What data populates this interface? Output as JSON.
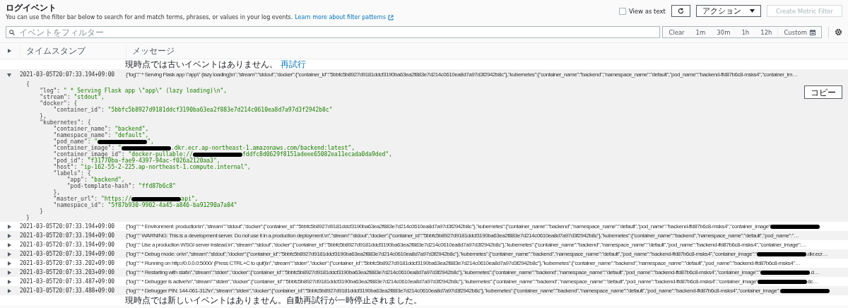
{
  "title": "ログイベント",
  "description": "You can use the filter bar below to search for and match terms, phrases, or values in your log events.",
  "learn_more_link": "Learn more about filter patterns",
  "view_as_text": {
    "label": "View as text",
    "checked": false
  },
  "actions_button": "アクション",
  "create_metric_filter": {
    "label": "Create Metric Filter",
    "disabled": true
  },
  "search": {
    "placeholder": "イベントをフィルター"
  },
  "time_ranges": [
    {
      "label": "Clear",
      "kind": "preset"
    },
    {
      "label": "1m",
      "kind": "preset"
    },
    {
      "label": "30m",
      "kind": "preset"
    },
    {
      "label": "1h",
      "kind": "preset"
    },
    {
      "label": "12h",
      "kind": "preset"
    },
    {
      "label": "Custom",
      "kind": "custom"
    }
  ],
  "columns": [
    "タイムスタンプ",
    "メッセージ"
  ],
  "older_notice": {
    "text": "現時点では古いイベントはありません。",
    "link": "再試行"
  },
  "copy_button": "コピー",
  "events": [
    {
      "timestamp": "2021-03-05T20:07:33.194+09:00",
      "expanded": true,
      "message": {
        "text": "{\"log\":\" * Serving Flask app \\\"app\\\" (lazy loading)\\n\",\"stream\":\"stdout\",\"docker\":{\"container_id\":\"5bbfc5b8927d9181ddcf3190ba63ea2f883e7d214c0610ea8d7a97d3f2942b8c\"},\"kubernetes\":{\"container_name\":\"backend\",\"namespace_name\":\"default\",\"pod_name\":\"backend-ffd87b6c8-msks4\",\"container_im…",
        "redacted": false
      },
      "detail_lines": [
        {
          "key": "{"
        },
        {
          "key": "    \"log\": ",
          "value": "\" * Serving Flask app \\\"app\\\" (lazy loading)\\n\","
        },
        {
          "key": "    \"stream\": ",
          "value": "\"stdout\","
        },
        {
          "key": "    \"docker\": {"
        },
        {
          "key": "        \"container_id\": ",
          "value": "\"5bbfc5b8927d9181ddcf3190ba63ea2f883e7d214c0610ea8d7a97d3f2942b8c\""
        },
        {
          "key": "    },"
        },
        {
          "key": "    \"kubernetes\": {"
        },
        {
          "key": "        \"container_name\": ",
          "value": "\"backend\","
        },
        {
          "key": "        \"namespace_name\": ",
          "value": "\"default\","
        },
        {
          "key": "        \"pod_name\": ",
          "value": "\"",
          "redacted": true,
          "after": "\","
        },
        {
          "key": "        \"container_image\": ",
          "value": "\"",
          "redacted": true,
          "after": ".dkr.ecr.ap-northeast-1.amazonaws.com/backend:latest\","
        },
        {
          "key": "        \"container_image_id\": ",
          "value": "\"docker-pullable://",
          "redacted": true,
          "after": "fddfc8d0629f8151adeee65082ea11ecada0da9ded\","
        },
        {
          "key": "        \"pod_id\": ",
          "value": "\"f31770ba-fae9-4397-94ac-f026a2120aa3\","
        },
        {
          "key": "        \"host\": ",
          "value": "\"ip-162-55-2-225.ap-northeast-1.compute.internal\","
        },
        {
          "key": "        \"labels\": {"
        },
        {
          "key": "            \"app\": ",
          "value": "\"backend\","
        },
        {
          "key": "            \"pod-template-hash\": ",
          "value": "\"ffd87b6c8\""
        },
        {
          "key": "        },"
        },
        {
          "key": "        \"master_url\": ",
          "value": "\"https://",
          "redacted": true,
          "after": "api\","
        },
        {
          "key": "        \"namespace_id\": ",
          "value": "\"5f87b930-9902-4a45-a846-ba91290a7a04\""
        },
        {
          "key": "    }"
        },
        {
          "key": "}"
        }
      ]
    },
    {
      "timestamp": "2021-03-05T20:07:33.194+09:00",
      "expanded": false,
      "message": {
        "text": "{\"log\":\" * Environment: production\\n\",\"stream\":\"stdout\",\"docker\":{\"container_id\":\"5bbfc5b8927d9181ddcf3190ba63ea2f883e7d214c0610ea8d7a97d3f2942b8c\"},\"kubernetes\":{\"container_name\":\"backend\",\"namespace_name\":\"default\",\"pod_name\":\"backend-ffd87b6c8-msks4\",\"container_image\"",
        "redacted": true
      }
    },
    {
      "timestamp": "2021-03-05T20:07:33.194+09:00",
      "expanded": false,
      "message": {
        "text": "{\"log\":\" WARNING: This is a development server. Do not use it in a production deployment.\\n\",\"stream\":\"stdout\",\"docker\":{\"container_id\":\"5bbfc5b8927d9181ddcf3190ba63ea2f883e7d214c0610ea8d7a97d3f2942b8c\"},\"kubernetes\":{\"container_name\":\"backend\",\"namespace_name\":\"default\",\"pod_name\":\"…",
        "redacted": false
      }
    },
    {
      "timestamp": "2021-03-05T20:07:33.194+09:00",
      "expanded": false,
      "message": {
        "text": "{\"log\":\" Use a production WSGI server instead.\\n\",\"stream\":\"stdout\",\"docker\":{\"container_id\":\"5bbfc5b8927d9181ddcf3190ba63ea2f883e7d214c0610ea8d7a97d3f2942b8c\"},\"kubernetes\":{\"container_name\":\"backend\",\"namespace_name\":\"default\",\"pod_name\":\"backend-ffd87b6c8-msks4\",\"container_image\":…",
        "redacted": false
      }
    },
    {
      "timestamp": "2021-03-05T20:07:33.194+09:00",
      "expanded": false,
      "message": {
        "text": "{\"log\":\" * Debug mode: on\\n\",\"stream\":\"stdout\",\"docker\":{\"container_id\":\"5bbfc5b8927d9181ddcf3190ba63ea2f883e7d214c0610ea8d7a97d3f2942b8c\"},\"kubernetes\":{\"container_name\":\"backend\",\"namespace_name\":\"default\",\"pod_name\":\"backend-ffd87b6c8-msks4\",\"container_image\":\"",
        "redacted": true,
        "after": ".dkr.ecr…"
      }
    },
    {
      "timestamp": "2021-03-05T20:07:33.202+09:00",
      "expanded": false,
      "message": {
        "text": "{\"log\":\" * Running on http://0.0.0.0:5000/ (Press CTRL+C to quit)\\n\",\"stream\":\"stderr\",\"docker\":{\"container_id\":\"5bbfc5b8927d9181ddcf3190ba63ea2f883e7d214c0610ea8d7a97d3f2942b8c\"},\"kubernetes\":{\"container_name\":\"backend\",\"namespace_name\":\"default\",\"pod_name\":\"backend-ffd87b6c8-msks4\"…",
        "redacted": false
      }
    },
    {
      "timestamp": "2021-03-05T20:07:33.203+09:00",
      "expanded": false,
      "message": {
        "text": "{\"log\":\" * Restarting with stat\\n\",\"stream\":\"stderr\",\"docker\":{\"container_id\":\"5bbfc5b8927d9181ddcf3190ba63ea2f883e7d214c0610ea8d7a97d3f2942b8c\"},\"kubernetes\":{\"container_name\":\"backend\",\"namespace_name\":\"default\",\"pod_name\":\"backend-ffd87b6c8-msks4\",\"container_image\":\"",
        "redacted": true,
        "after": ".d…"
      }
    },
    {
      "timestamp": "2021-03-05T20:07:33.487+09:00",
      "expanded": false,
      "message": {
        "text": "{\"log\":\" * Debugger is active!\\n\",\"stream\":\"stderr\",\"docker\":{\"container_id\":\"5bbfc5b8927d9181ddcf3190ba63ea2f883e7d214c0610ea8d7a97d3f2942b8c\"},\"kubernetes\":{\"container_name\":\"backend\",\"namespace_name\":\"default\",\"pod_name\":\"backend-ffd87b6c8-msks4\",\"container_image\"",
        "redacted": true,
        "after": "dc…"
      }
    },
    {
      "timestamp": "2021-03-05T20:07:33.488+09:00",
      "expanded": false,
      "message": {
        "text": "{\"log\":\" * Debugger PIN: 144-061-312\\n\",\"stream\":\"stderr\",\"docker\":{\"container_id\":\"5bbfc5b8927d9181ddcf3190ba63ea2f883e7d214c0610ea8d7a97d3f2942b8c\"},\"kubernetes\":{\"container_name\":\"backend\",\"namespace_name\":\"default\",\"pod_name\":\"backend-ffd87b6c8-msks4\",\"container_image\":",
        "redacted": true
      }
    }
  ],
  "newer_notice": "現時点では新しいイベントはありません。自動再試行が一時停止されました。"
}
